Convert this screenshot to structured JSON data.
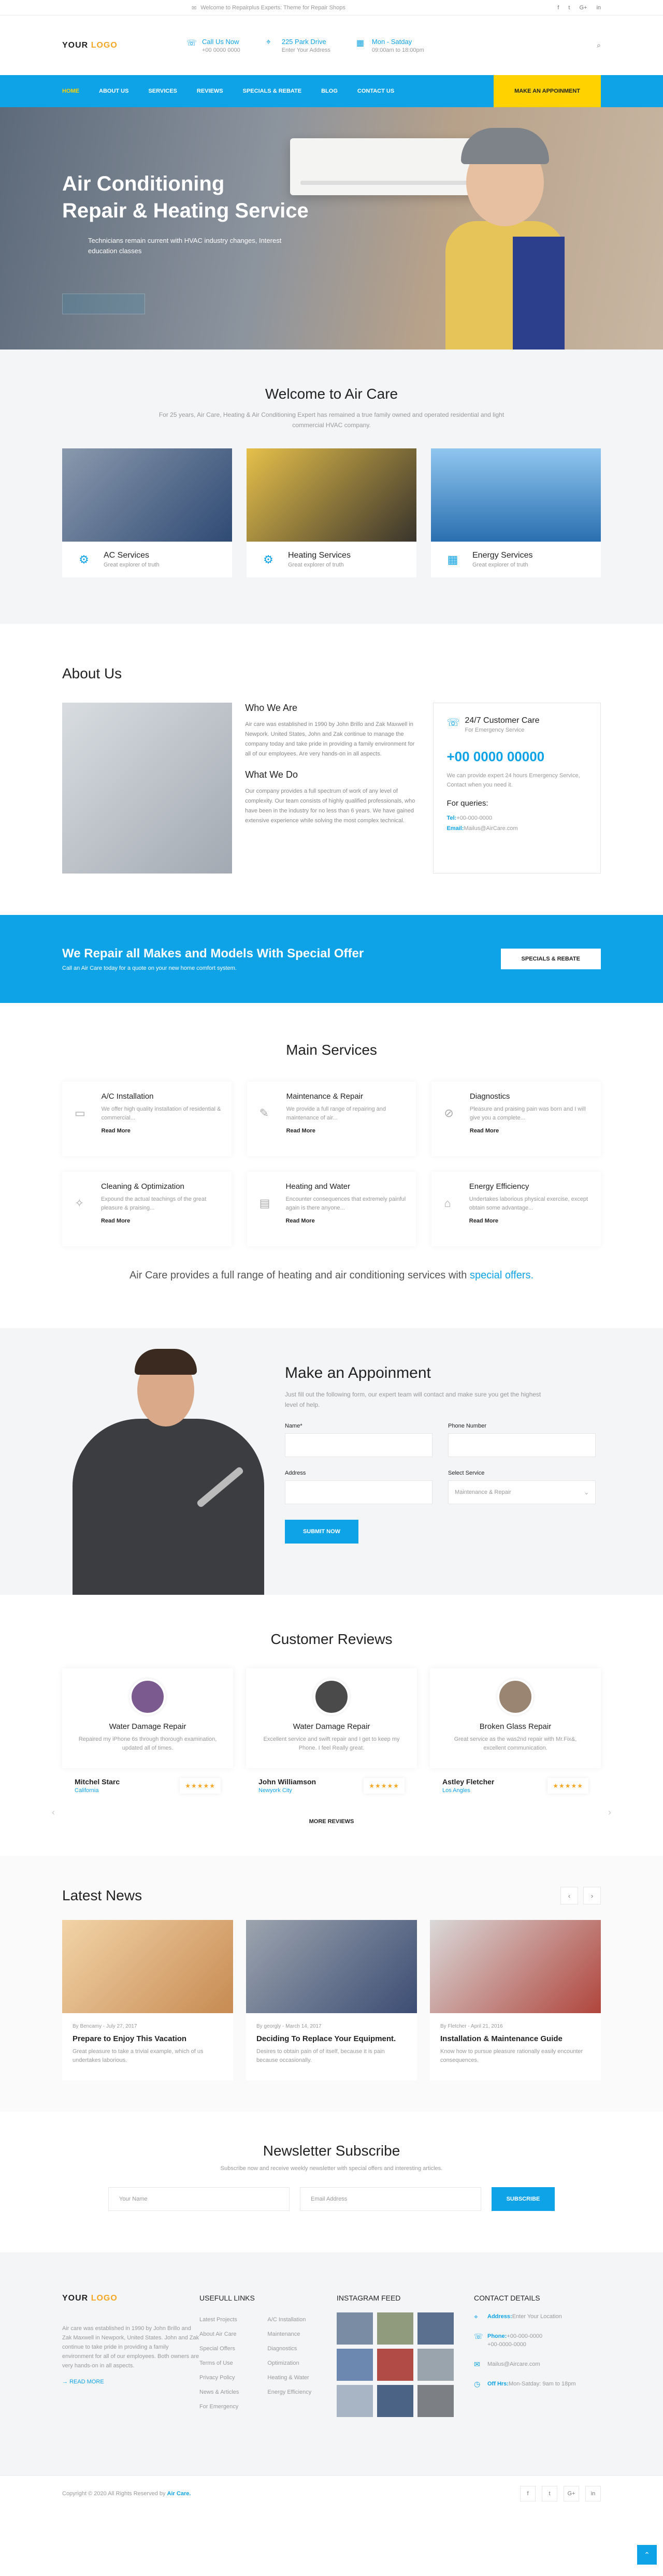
{
  "topbar": {
    "welcome": "Welcome to Repairplus Experts: Theme for Repair Shops",
    "social": [
      "f",
      "t",
      "G+",
      "in"
    ]
  },
  "header": {
    "logo_main": "YOUR",
    "logo_accent": "LOGO",
    "info": [
      {
        "title": "Call Us Now",
        "sub": "+00 0000 0000"
      },
      {
        "title": "225 Park Drive",
        "sub": "Enter Your Address"
      },
      {
        "title": "Mon - Satday",
        "sub": "09:00am to 18:00pm"
      }
    ]
  },
  "nav": {
    "items": [
      "HOME",
      "ABOUT US",
      "SERVICES",
      "REVIEWS",
      "SPECIALS & REBATE",
      "BLOG",
      "CONTACT US"
    ],
    "cta": "MAKE AN APPOINMENT"
  },
  "hero": {
    "line1": "Air Conditioning",
    "line2": "Repair & Heating Service",
    "text": "Technicians remain current with HVAC industry changes, Interest education classes"
  },
  "welcome": {
    "title": "Welcome to Air Care",
    "sub": "For 25 years, Air Care, Heating & Air Conditioning Expert has remained a true family owned and operated residential and light commercial HVAC company.",
    "cards": [
      {
        "title": "AC Services",
        "sub": "Great explorer of truth",
        "icon": "gear-icon"
      },
      {
        "title": "Heating Services",
        "sub": "Great explorer of truth",
        "icon": "gear-icon"
      },
      {
        "title": "Energy Services",
        "sub": "Great explorer of truth",
        "icon": "solar-panel-icon"
      }
    ]
  },
  "about": {
    "title": "About Us",
    "who_title": "Who We Are",
    "who_text": "Air care was established in 1990 by John Brillo and Zak Maxwell in Newpork. United States, John and Zak continue to manage the company today and take pride in providing a family environment for all of our employees. Are very hands-on in all aspects.",
    "do_title": "What We Do",
    "do_text": "Our company provides a full spectrum of work of any level of complexity. Our team consists of highly qualified professionals, who have been in the industry for no less than 6 years. We have gained extensive experience while solving the most complex technical.",
    "box": {
      "title": "24/7 Customer Care",
      "sub": "For Emergency Service",
      "phone": "+00 0000 00000",
      "text": "We can provide expert 24 hours Emergency Service, Contact when you need it.",
      "queries_title": "For queries:",
      "tel_label": "Tel:",
      "tel": "+00-000-0000",
      "email_label": "Email:",
      "email": "Mailus@AirCare.com"
    }
  },
  "special": {
    "title": "We Repair all Makes and Models With Special Offer",
    "sub": "Call an Air Care today for a quote on your new home comfort system.",
    "button": "SPECIALS & REBATE"
  },
  "main_services": {
    "title": "Main Services",
    "items": [
      {
        "title": "A/C Installation",
        "text": "We offer high quality installation of residential & commercial...",
        "icon": "ac-unit-icon"
      },
      {
        "title": "Maintenance & Repair",
        "text": "We provide a full range of repairing and maintenance of air...",
        "icon": "wrench-icon"
      },
      {
        "title": "Diagnostics",
        "text": "Pleasure and praising pain was born and I will give you a complete...",
        "icon": "diagnostics-icon"
      },
      {
        "title": "Cleaning & Optimization",
        "text": "Expound the actual teachings of the great pleasure & praising...",
        "icon": "cleaning-icon"
      },
      {
        "title": "Heating and Water",
        "text": "Encounter consequences that extremely painful again is there anyone...",
        "icon": "heater-icon"
      },
      {
        "title": "Energy Efficiency",
        "text": "Undertakes laborious physical exercise, except obtain some advantage...",
        "icon": "energy-icon"
      }
    ],
    "read_more": "Read More",
    "footer_text": "Air Care provides a full range of heating and air conditioning services with",
    "footer_link": "special offers."
  },
  "appointment": {
    "title": "Make an Appoinment",
    "sub": "Just fill out the following form, our expert team will contact and make sure you get the highest level of help.",
    "name_label": "Name*",
    "phone_label": "Phone Number",
    "address_label": "Address",
    "service_label": "Select Service",
    "service_value": "Maintenance & Repair",
    "submit": "SUBMIT NOW"
  },
  "reviews": {
    "title": "Customer Reviews",
    "items": [
      {
        "title": "Water Damage Repair",
        "text": "Repaired my iPhone 6s through thorough examination, updated all of times.",
        "name": "Mitchel Starc",
        "loc": "California",
        "stars": "★★★★★"
      },
      {
        "title": "Water Damage Repair",
        "text": "Excellent service and swift repair and I get to keep my Phone. I feel Really great.",
        "name": "John Williamson",
        "loc": "Newyork City",
        "stars": "★★★★★"
      },
      {
        "title": "Broken Glass Repair",
        "text": "Great service as the was2nd repair with Mr.Fix&, excellent communication.",
        "name": "Astley Fletcher",
        "loc": "Los Angles",
        "stars": "★★★★★"
      }
    ],
    "more": "MORE REVIEWS"
  },
  "news": {
    "title": "Latest News",
    "items": [
      {
        "meta": "By Bencamy  -  July 27, 2017",
        "title": "Prepare to Enjoy This Vacation",
        "text": "Great pleasure to take a trivial example, which of us undertakes laborious."
      },
      {
        "meta": "By georgly  -  March 14, 2017",
        "title": "Deciding To Replace Your Equipment.",
        "text": "Desires to obtain pain of of itself, because it is pain because occasionally."
      },
      {
        "meta": "By Fletcher  -  April 21, 2016",
        "title": "Installation & Maintenance Guide",
        "text": "Know how to pursue pleasure rationally easily encounter consequences."
      }
    ]
  },
  "newsletter": {
    "title": "Newsletter Subscribe",
    "sub": "Subscribe now and receive weekly newsletter with special offers and interesting articles.",
    "name_ph": "Your Name",
    "email_ph": "Email Address",
    "button": "SUBSCRIBE"
  },
  "footer": {
    "about_text": "Air care was established in 1990 by John Brillo and Zak Maxwell in Newpork, United States. John and Zak continue to take pride in providing a family environment for all of our employees. Both owners are very hands-on in all aspects.",
    "read_more": "READ MORE",
    "links_title": "USEFULL LINKS",
    "links_col1": [
      "Latest Projects",
      "About Air Care",
      "Special Offers",
      "Terms of Use",
      "Privacy Policy",
      "News & Articles",
      "For Emergency"
    ],
    "links_col2": [
      "A/C Installation",
      "Maintenance",
      "Diagnostics",
      "Optimization",
      "Heating & Water",
      "Energy Efficiency"
    ],
    "insta_title": "INSTAGRAM FEED",
    "contact_title": "CONTACT DETAILS",
    "address_label": "Address:",
    "address": "Enter Your Location",
    "phone_label": "Phone:",
    "phone": "+00-000-0000\n+00-0000-0000",
    "email": "Mailus@Aircare.com",
    "off_label": "Off Hrs:",
    "off": "Mon-Satday: 9am to 18pm",
    "copyright": "Copyright © 2020 All Rights Reserved by",
    "copyright_brand": "Air Care.",
    "social": [
      "f",
      "t",
      "G+",
      "in"
    ]
  }
}
